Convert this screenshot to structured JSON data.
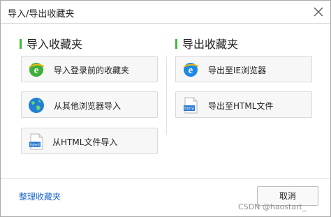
{
  "window": {
    "title": "导入/导出收藏夹"
  },
  "import_section": {
    "heading": "导入收藏夹",
    "buttons": [
      {
        "label": "导入登录前的收藏夹",
        "icon": "ie-icon"
      },
      {
        "label": "从其他浏览器导入",
        "icon": "globe-icon"
      },
      {
        "label": "从HTML文件导入",
        "icon": "html-file-icon"
      }
    ]
  },
  "export_section": {
    "heading": "导出收藏夹",
    "buttons": [
      {
        "label": "导出至IE浏览器",
        "icon": "ie-icon"
      },
      {
        "label": "导出至HTML文件",
        "icon": "html-file-icon"
      }
    ]
  },
  "footer": {
    "manage_link": "整理收藏夹",
    "cancel_label": "取消"
  },
  "watermark": "CSDN @haostart_",
  "colors": {
    "accent_bar": "#3dbb3d",
    "link": "#1a66c8",
    "ie_blue": "#1e88e5"
  }
}
